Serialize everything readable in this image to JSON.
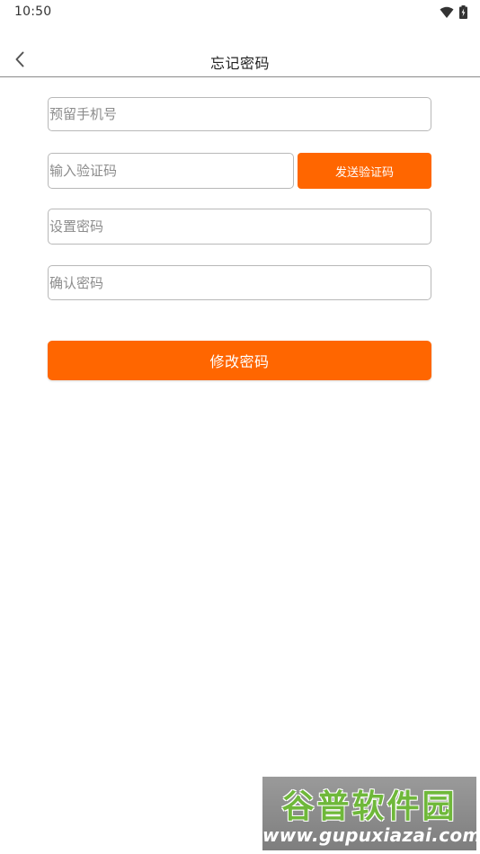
{
  "status_bar": {
    "time": "10:50",
    "icons": [
      "wifi-icon",
      "battery-icon"
    ]
  },
  "header": {
    "title": "忘记密码",
    "back_icon": "chevron-left-icon"
  },
  "form": {
    "phone": {
      "placeholder": "预留手机号",
      "value": ""
    },
    "code": {
      "placeholder": "输入验证码",
      "value": ""
    },
    "send_code_label": "发送验证码",
    "new_password": {
      "placeholder": "设置密码",
      "value": ""
    },
    "confirm_password": {
      "placeholder": "确认密码",
      "value": ""
    },
    "submit_label": "修改密码"
  },
  "watermark": {
    "brand": "谷普软件园",
    "url": "www.gupuxiazai.com"
  },
  "colors": {
    "accent": "#ff6600",
    "field_border": "#b8b8b8",
    "placeholder": "#8c8c8c"
  }
}
